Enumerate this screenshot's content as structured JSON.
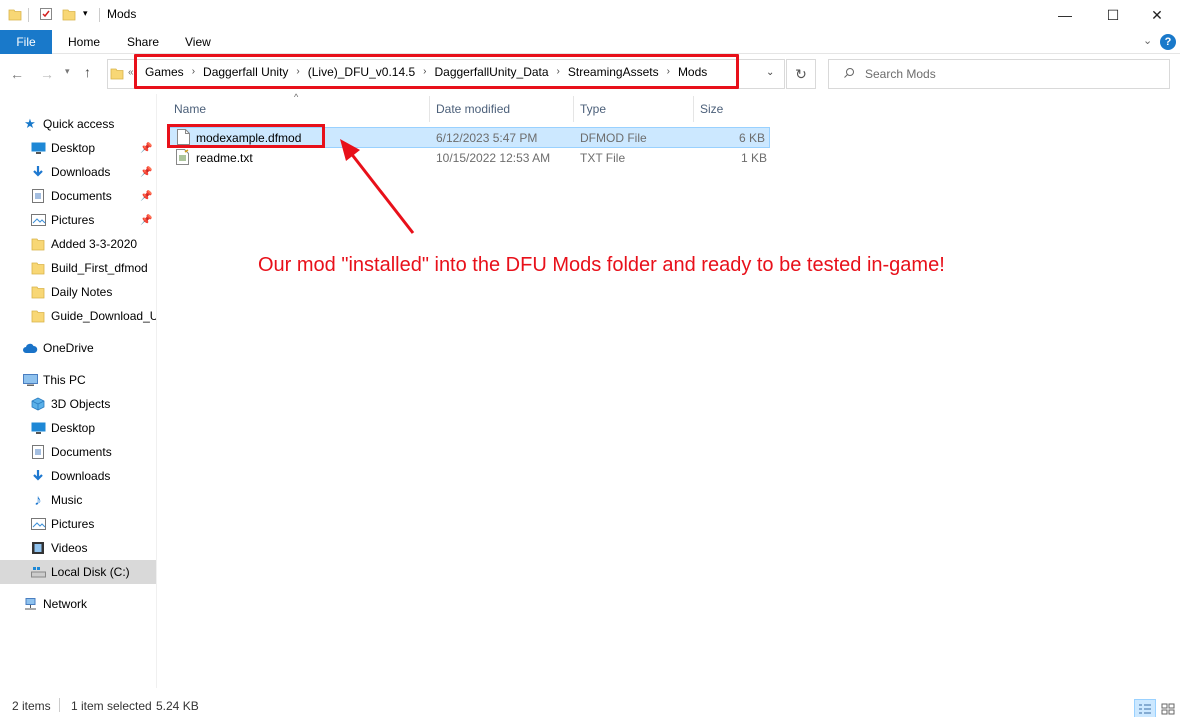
{
  "window": {
    "title": "Mods",
    "minimize": "—",
    "maximize": "☐",
    "close": "✕"
  },
  "ribbon": {
    "tabs": [
      "File",
      "Home",
      "Share",
      "View"
    ],
    "help": "?"
  },
  "address": {
    "crumbs": [
      "Games",
      "Daggerfall Unity",
      "(Live)_DFU_v0.14.5",
      "DaggerfallUnity_Data",
      "StreamingAssets",
      "Mods"
    ],
    "separator": "›"
  },
  "search": {
    "placeholder": "Search Mods"
  },
  "sidebar": {
    "quick_access": "Quick access",
    "quick_items": [
      {
        "label": "Desktop",
        "icon": "desktop-icon",
        "pinned": true
      },
      {
        "label": "Downloads",
        "icon": "downloads-icon",
        "pinned": true
      },
      {
        "label": "Documents",
        "icon": "documents-icon",
        "pinned": true
      },
      {
        "label": "Pictures",
        "icon": "pictures-icon",
        "pinned": true
      },
      {
        "label": "Added 3-3-2020",
        "icon": "folder-icon",
        "pinned": false
      },
      {
        "label": "Build_First_dfmod",
        "icon": "folder-icon",
        "pinned": false
      },
      {
        "label": "Daily Notes",
        "icon": "folder-icon",
        "pinned": false
      },
      {
        "label": "Guide_Download_U",
        "icon": "folder-icon",
        "pinned": false
      }
    ],
    "onedrive": "OneDrive",
    "this_pc": "This PC",
    "pc_items": [
      {
        "label": "3D Objects",
        "icon": "3d-objects-icon"
      },
      {
        "label": "Desktop",
        "icon": "desktop-icon"
      },
      {
        "label": "Documents",
        "icon": "documents-icon"
      },
      {
        "label": "Downloads",
        "icon": "downloads-icon"
      },
      {
        "label": "Music",
        "icon": "music-icon"
      },
      {
        "label": "Pictures",
        "icon": "pictures-icon"
      },
      {
        "label": "Videos",
        "icon": "videos-icon"
      },
      {
        "label": "Local Disk (C:)",
        "icon": "local-disk-icon",
        "selected": true
      }
    ],
    "network": "Network"
  },
  "columns": {
    "name": "Name",
    "date": "Date modified",
    "type": "Type",
    "size": "Size"
  },
  "files": [
    {
      "name": "modexample.dfmod",
      "date": "6/12/2023 5:47 PM",
      "type": "DFMOD File",
      "size": "6 KB",
      "selected": true
    },
    {
      "name": "readme.txt",
      "date": "10/15/2022 12:53 AM",
      "type": "TXT File",
      "size": "1 KB",
      "selected": false
    }
  ],
  "annotation": {
    "text": "Our mod \"installed\" into the DFU Mods folder and ready to be tested in-game!"
  },
  "status": {
    "items": "2 items",
    "selected": "1 item selected",
    "size": "5.24 KB"
  },
  "colors": {
    "accent": "#1979ca",
    "highlight": "#e8101a",
    "selection": "#cce8ff"
  }
}
